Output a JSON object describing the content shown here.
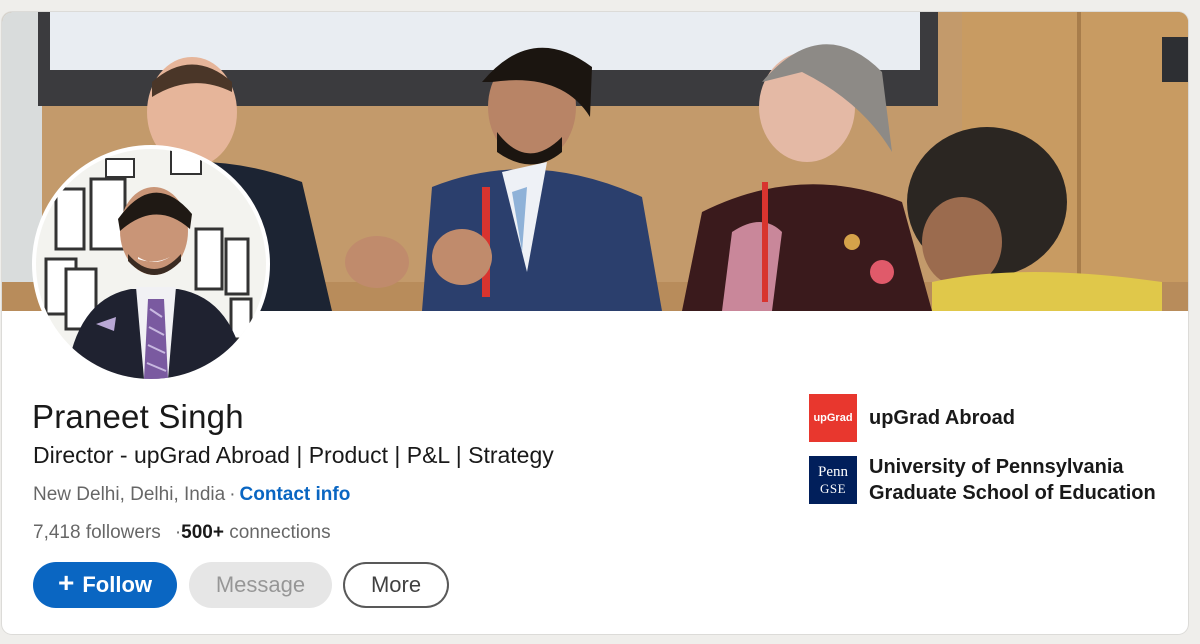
{
  "profile": {
    "name": "Praneet Singh",
    "headline": "Director - upGrad Abroad | Product | P&L | Strategy",
    "location": "New Delhi, Delhi, India",
    "separator": "·",
    "contact_info": "Contact info",
    "followers": "7,418",
    "followers_label": "followers",
    "connections": "500+",
    "connections_label": "connections"
  },
  "actions": {
    "follow_icon": "+",
    "follow": "Follow",
    "message": "Message",
    "more": "More"
  },
  "experience": [
    {
      "logo_text": "upGrad",
      "name": "upGrad Abroad"
    },
    {
      "logo_text_1": "Penn",
      "logo_text_2": "GSE",
      "name_line1": "University of Pennsylvania",
      "name_line2": "Graduate School of Education"
    }
  ],
  "colors": {
    "primary": "#0a66c2",
    "upgrad_red": "#e8372e",
    "penn_navy": "#011f5b"
  },
  "icons": [
    "banner-photo",
    "profile-photo",
    "upgrad-logo",
    "penn-gse-logo",
    "plus-icon"
  ]
}
